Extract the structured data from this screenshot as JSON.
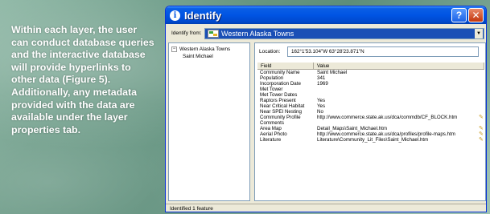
{
  "caption": "Within each layer, the user can conduct database queries and the interactive database will provide hyperlinks to other data (Figure 5). Additionally, any metadata provided with the data are available under the layer properties tab.",
  "window": {
    "title": "Identify",
    "help_label": "?",
    "close_label": "✕",
    "identify_from_label": "Identify from:",
    "identify_from_value": "Western Alaska Towns",
    "location_label": "Location:",
    "location_value": "162°1'53.104\"W  63°28'23.871\"N",
    "status": "Identified 1 feature"
  },
  "tree": {
    "layer": "Western Alaska Towns",
    "feature": "Saint Michael"
  },
  "grid": {
    "columns": [
      "Field",
      "Value"
    ],
    "rows": [
      {
        "field": "Community Name",
        "value": "Saint Michael",
        "link": false
      },
      {
        "field": "Population",
        "value": "341",
        "link": false
      },
      {
        "field": "Incorporation Date",
        "value": "1969",
        "link": false
      },
      {
        "field": "Met Tower",
        "value": "",
        "link": false
      },
      {
        "field": "Met Tower Dates",
        "value": "",
        "link": false
      },
      {
        "field": "Raptors Present",
        "value": "Yes",
        "link": false
      },
      {
        "field": "Near Critical Habitat",
        "value": "Yes",
        "link": false
      },
      {
        "field": "Near SPEI Nesting",
        "value": "No",
        "link": false
      },
      {
        "field": "Community Profile",
        "value": "http://www.commerce.state.ak.us/dca/commdb/CF_BLOCK.htm",
        "link": true
      },
      {
        "field": "Comments",
        "value": "",
        "link": false
      },
      {
        "field": "Area Map",
        "value": "Detail_Maps\\Saint_Michael.htm",
        "link": true
      },
      {
        "field": "Aerial Photo",
        "value": "http://www.commerce.state.ak.us/dca/profiles/profile-maps.htm",
        "link": true
      },
      {
        "field": "Literature",
        "value": "Literature\\Community_Lit_Files\\Saint_Michael.htm",
        "link": true
      }
    ]
  },
  "colors": {
    "titlebar": "#0054e3",
    "window_bg": "#ece9d8",
    "combo_selected": "#1a4fb6"
  }
}
